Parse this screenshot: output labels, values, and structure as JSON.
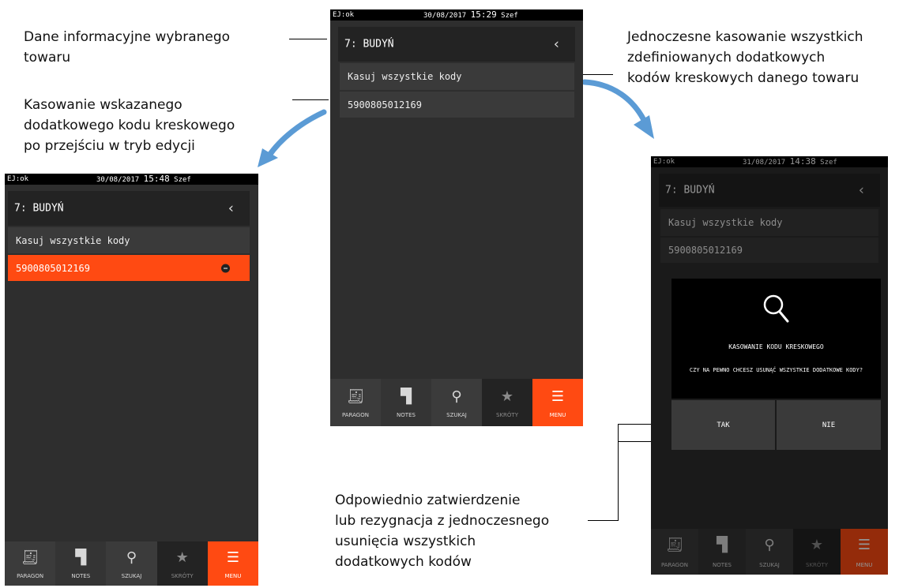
{
  "captions": {
    "dane": "Dane informacyjne wybranego\ntowaru",
    "kasowanie_wskazanego": "Kasowanie wskazanego\ndodatkowego kodu kreskowego\npo przejściu w tryb edycji",
    "jednoczesne": "Jednoczesne kasowanie wszystkich\nzdefiniowanych dodatkowych\nkodów kreskowych danego towaru",
    "odpowiednio": "Odpowiednio zatwierdzenie\nlub rezygnacja z jednoczesnego\nusunięcia wszystkich\ndodatkowych kodów"
  },
  "center": {
    "status_ej": "EJ:ok",
    "status_date": "30/08/2017",
    "status_time": "15:29",
    "status_user": "Szef",
    "title": "7: BUDYŃ",
    "back": "‹",
    "delete_all": "Kasuj wszystkie kody",
    "barcode": "5900805012169"
  },
  "left": {
    "status_ej": "EJ:ok",
    "status_date": "30/08/2017",
    "status_time": "15:48",
    "status_user": "Szef",
    "title": "7: BUDYŃ",
    "back": "‹",
    "delete_all": "Kasuj wszystkie kody",
    "barcode": "5900805012169"
  },
  "right": {
    "status_ej": "EJ:ok",
    "status_date": "31/08/2017",
    "status_time": "14:38",
    "status_user": "Szef",
    "title": "7: BUDYŃ",
    "back": "‹",
    "delete_all": "Kasuj wszystkie kody",
    "barcode": "5900805012169",
    "dialog": {
      "icon": "search-icon",
      "title": "KASOWANIE KODU KRESKOWEGO",
      "question": "CZY NA PEWNO CHCESZ USUNĄĆ WSZYSTKIE DODATKOWE KODY?",
      "yes": "TAK",
      "no": "NIE"
    }
  },
  "nav": {
    "paragon": "PARAGON",
    "notes": "NOTES",
    "szukaj": "SZUKAJ",
    "skroty": "SKRÓTY",
    "menu": "MENU",
    "icons": [
      "receipt-icon",
      "notes-icon",
      "search-icon",
      "star-icon",
      "menu-icon"
    ]
  },
  "colors": {
    "accent": "#ff4a12",
    "background": "#2e2e2e",
    "arrow": "#5b9bd5"
  }
}
